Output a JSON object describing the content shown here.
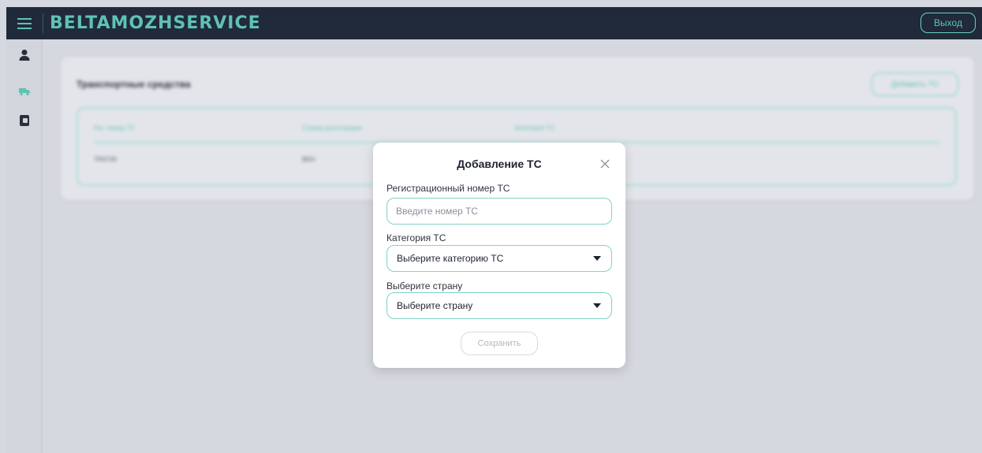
{
  "header": {
    "brand": "BELTAMOZHSERVICE",
    "logout_label": "Выход"
  },
  "sidebar": {
    "items": [
      {
        "icon": "user-icon"
      },
      {
        "icon": "truck-icon"
      },
      {
        "icon": "document-icon"
      }
    ]
  },
  "page": {
    "title": "Транспортные средства",
    "add_button_label": "Добавить ТС",
    "table": {
      "columns": [
        "Рег. номер ТС",
        "Страна регистрации",
        "Категория ТС"
      ],
      "rows": [
        [
          "TR4729",
          "BEH",
          ""
        ]
      ]
    }
  },
  "modal": {
    "title": "Добавление ТС",
    "reg_number": {
      "label": "Регистрационный номер ТС",
      "placeholder": "Введите номер ТС",
      "value": ""
    },
    "category": {
      "label": "Категория ТС",
      "selected": "Выберите категорию ТС"
    },
    "country": {
      "label": "Выберите страну",
      "selected": "Выберите страну"
    },
    "save_label": "Сохранить"
  },
  "colors": {
    "header_bg": "#202a3a",
    "accent": "#5fc2b2",
    "accent_border": "#7fd4c6",
    "page_bg": "#d6d8df",
    "modal_bg": "#ffffff"
  }
}
